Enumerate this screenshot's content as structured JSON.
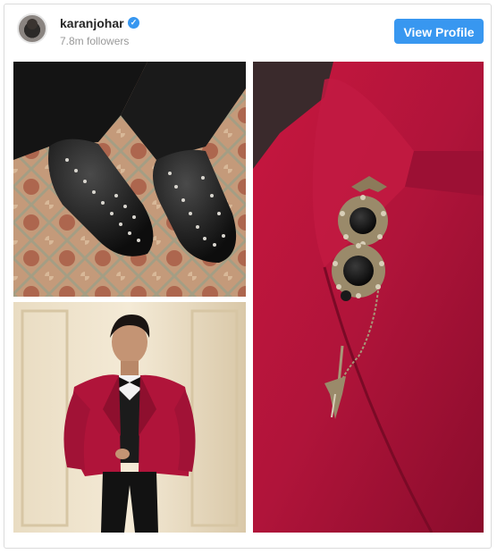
{
  "post": {
    "username": "karanjohar",
    "followers": "7.8m followers",
    "view_profile_label": "View Profile"
  },
  "icons": {
    "verified": "verified-badge-icon"
  },
  "colors": {
    "accent": "#3897f0",
    "blazer": "#b0143a",
    "text": "#262626",
    "muted": "#999999"
  }
}
